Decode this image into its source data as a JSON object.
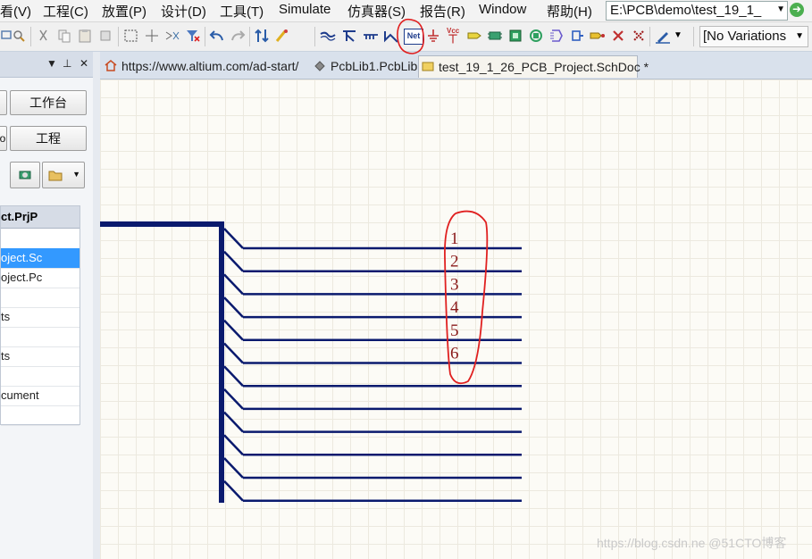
{
  "menubar": {
    "items": [
      "看(V)",
      "工程(C)",
      "放置(P)",
      "设计(D)",
      "工具(T)",
      "Simulate",
      "仿真器(S)",
      "报告(R)",
      "Window",
      "帮助(H)"
    ],
    "path": "E:\\PCB\\demo\\test_19_1_"
  },
  "toolbar": {
    "net_label": "Net",
    "vcc_label": "Vcc",
    "variations": "[No Variations"
  },
  "panel": {
    "workbench_button": "工作台",
    "project_button": "工程",
    "left_button_fragment": "o",
    "tree_header": "ct.PrjP",
    "tree_rows": [
      "",
      "oject.Sc",
      "oject.Pc",
      "",
      "ts",
      "",
      "ts",
      "",
      "cument",
      ""
    ]
  },
  "tabs": [
    {
      "label": "https://www.altium.com/ad-start/",
      "icon": "home-icon"
    },
    {
      "label": "PcbLib1.PcbLib",
      "icon": "pcb-icon"
    },
    {
      "label": "test_19_1_26_PCB_Project.SchDoc *",
      "icon": "schdoc-icon"
    }
  ],
  "schematic": {
    "bus_color": "#0a1a6e",
    "annotation_color": "#e02020",
    "label_color": "#8a1a1a",
    "entry_count": 12,
    "net_labels": [
      "1",
      "2",
      "3",
      "4",
      "5",
      "6"
    ]
  },
  "watermark": "https://blog.csdn.ne @51CTO博客"
}
